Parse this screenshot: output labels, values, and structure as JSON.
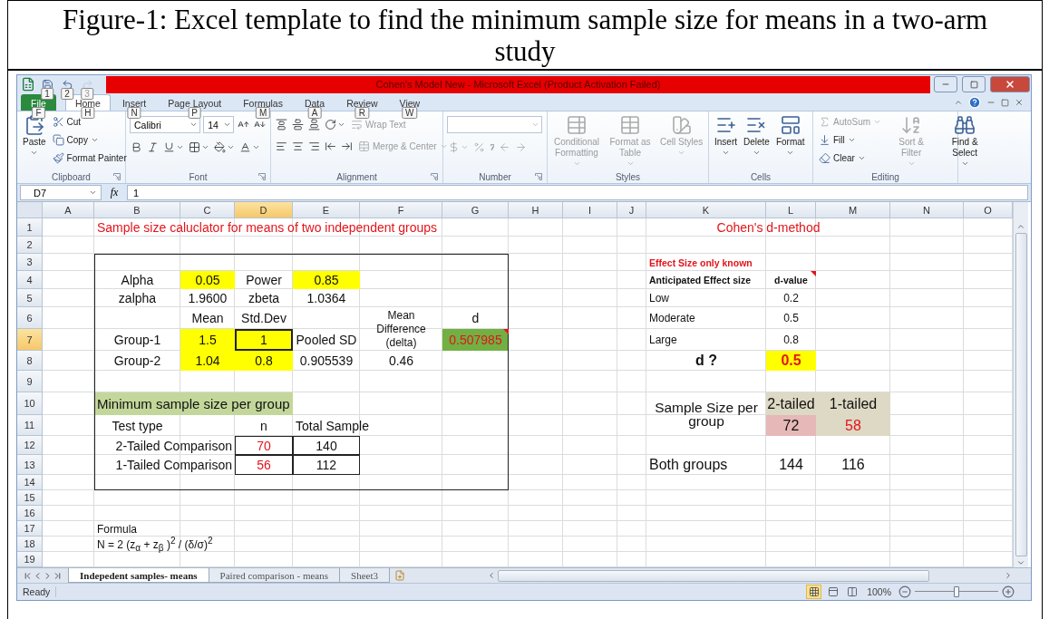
{
  "caption": "Figure-1: Excel template to find the minimum sample size for means in a two-arm study",
  "window": {
    "title": "Cohen's Model New - Microsoft Excel (Product Activation Failed)"
  },
  "quick_access": [
    {
      "keytip": "1",
      "disabled": false
    },
    {
      "keytip": "2",
      "disabled": false
    },
    {
      "keytip": "3",
      "disabled": true
    }
  ],
  "ribbon_tabs": [
    {
      "label": "File",
      "keytip": "F",
      "kind": "file",
      "selected": false
    },
    {
      "label": "Home",
      "keytip": "H",
      "kind": "tab",
      "selected": true
    },
    {
      "label": "Insert",
      "keytip": "N",
      "kind": "tab",
      "selected": false
    },
    {
      "label": "Page Layout",
      "keytip": "P",
      "kind": "tab",
      "selected": false
    },
    {
      "label": "Formulas",
      "keytip": "M",
      "kind": "tab",
      "selected": false
    },
    {
      "label": "Data",
      "keytip": "A",
      "kind": "tab",
      "selected": false
    },
    {
      "label": "Review",
      "keytip": "R",
      "kind": "tab",
      "selected": false
    },
    {
      "label": "View",
      "keytip": "W",
      "kind": "tab",
      "selected": false
    }
  ],
  "ribbon_groups": [
    {
      "label": "Clipboard",
      "kind": "stack",
      "launcher": true,
      "buttons": [
        {
          "label": "Paste",
          "kind": "large",
          "dropdown": true,
          "disabled": false
        },
        {
          "label": "Cut",
          "kind": "small",
          "dropdown": false,
          "disabled": false
        },
        {
          "label": "Copy",
          "kind": "small",
          "dropdown": true,
          "disabled": false
        },
        {
          "label": "Format Painter",
          "kind": "small",
          "dropdown": false,
          "disabled": false
        }
      ]
    },
    {
      "label": "Font",
      "kind": "rows",
      "launcher": true,
      "rows": [
        [
          {
            "kind": "field",
            "value": "Calibri"
          },
          {
            "kind": "field",
            "value": "14"
          },
          {
            "kind": "icon",
            "dropdown": false,
            "disabled": false
          },
          {
            "kind": "icon",
            "dropdown": false,
            "disabled": false
          }
        ],
        [
          {
            "kind": "icon",
            "dropdown": false,
            "disabled": false
          },
          {
            "kind": "icon",
            "dropdown": false,
            "disabled": false
          },
          {
            "kind": "icon",
            "dropdown": true,
            "disabled": false
          },
          {
            "kind": "icon",
            "dropdown": true,
            "disabled": false
          },
          {
            "kind": "icon",
            "dropdown": true,
            "disabled": false
          },
          {
            "kind": "icon",
            "dropdown": true,
            "disabled": false
          }
        ]
      ]
    },
    {
      "label": "Alignment",
      "kind": "rows",
      "launcher": true,
      "rows": [
        [
          {
            "kind": "icon",
            "dropdown": false,
            "disabled": false
          },
          {
            "kind": "icon",
            "dropdown": false,
            "disabled": false
          },
          {
            "kind": "icon",
            "dropdown": false,
            "disabled": false
          },
          {
            "kind": "icon",
            "dropdown": true,
            "disabled": false
          },
          {
            "kind": "small",
            "label": "Wrap Text",
            "dropdown": false,
            "disabled": true
          }
        ],
        [
          {
            "kind": "icon",
            "dropdown": false,
            "disabled": false
          },
          {
            "kind": "icon",
            "dropdown": false,
            "disabled": false
          },
          {
            "kind": "icon",
            "dropdown": false,
            "disabled": false
          },
          {
            "kind": "icon",
            "dropdown": false,
            "disabled": false
          },
          {
            "kind": "icon",
            "dropdown": false,
            "disabled": false
          },
          {
            "kind": "small",
            "label": "Merge & Center",
            "dropdown": true,
            "disabled": true
          }
        ]
      ]
    },
    {
      "label": "Number",
      "kind": "rows",
      "launcher": true,
      "rows": [
        [
          {
            "kind": "field"
          }
        ],
        [
          {
            "kind": "icon",
            "dropdown": true,
            "disabled": true
          },
          {
            "kind": "icon",
            "dropdown": false,
            "disabled": true
          },
          {
            "kind": "icon",
            "dropdown": false,
            "disabled": true
          },
          {
            "kind": "icon",
            "dropdown": false,
            "disabled": true
          },
          {
            "kind": "icon",
            "dropdown": false,
            "disabled": true
          }
        ]
      ]
    },
    {
      "label": "Styles",
      "kind": "stack",
      "launcher": false,
      "buttons": [
        {
          "label": "Conditional Formatting",
          "kind": "large",
          "dropdown": true,
          "disabled": true
        },
        {
          "label": "Format as Table",
          "kind": "large",
          "dropdown": true,
          "disabled": true
        },
        {
          "label": "Cell Styles",
          "kind": "large",
          "dropdown": true,
          "disabled": true
        }
      ]
    },
    {
      "label": "Cells",
      "kind": "stack",
      "launcher": false,
      "buttons": [
        {
          "label": "Insert",
          "kind": "large",
          "dropdown": true,
          "disabled": false
        },
        {
          "label": "Delete",
          "kind": "large",
          "dropdown": true,
          "disabled": false
        },
        {
          "label": "Format",
          "kind": "large",
          "dropdown": true,
          "disabled": false
        }
      ]
    },
    {
      "label": "Editing",
      "kind": "stack",
      "launcher": false,
      "buttons": [
        {
          "label": "AutoSum",
          "kind": "small",
          "dropdown": true,
          "disabled": true
        },
        {
          "label": "Fill",
          "kind": "small",
          "dropdown": true,
          "disabled": false
        },
        {
          "label": "Clear",
          "kind": "small",
          "dropdown": true,
          "disabled": false
        },
        {
          "label": "Sort & Filter",
          "kind": "large",
          "dropdown": true,
          "disabled": true
        },
        {
          "label": "Find & Select",
          "kind": "large",
          "dropdown": true,
          "disabled": false
        }
      ]
    }
  ],
  "formula_bar": {
    "name_box": "D7",
    "fx": "fx",
    "value": "1"
  },
  "sheet": {
    "columns": [
      {
        "label": "A",
        "selected": false
      },
      {
        "label": "B",
        "selected": false
      },
      {
        "label": "C",
        "selected": false
      },
      {
        "label": "D",
        "selected": true
      },
      {
        "label": "E",
        "selected": false
      },
      {
        "label": "F",
        "selected": false
      },
      {
        "label": "G",
        "selected": false
      },
      {
        "label": "H",
        "selected": false
      },
      {
        "label": "I",
        "selected": false
      },
      {
        "label": "J",
        "selected": false
      },
      {
        "label": "K",
        "selected": false
      },
      {
        "label": "L",
        "selected": false
      },
      {
        "label": "M",
        "selected": false
      },
      {
        "label": "N",
        "selected": false
      },
      {
        "label": "O",
        "selected": false
      }
    ],
    "rows": [
      {
        "number": "1",
        "selected": false,
        "cells": [
          "",
          {
            "text": "Sample size caluclator for means of two independent groups",
            "kind": "title",
            "alert": true
          },
          "",
          "",
          "",
          "",
          "",
          "",
          "",
          "",
          {
            "text": "Cohen's d-method",
            "kind": "heading",
            "alert": true
          }
        ]
      },
      {
        "number": "2",
        "selected": false,
        "cells": []
      },
      {
        "number": "3",
        "selected": false,
        "cells": [
          "",
          "",
          "",
          "",
          "",
          "",
          "",
          "",
          "",
          "",
          {
            "text": "Effect Size only known",
            "kind": "small-bold-left",
            "alert": true
          }
        ]
      },
      {
        "number": "4",
        "selected": false,
        "cells": [
          "",
          {
            "text": "Alpha",
            "kind": "label"
          },
          {
            "text": "0.05",
            "kind": "input"
          },
          {
            "text": "Power",
            "kind": "label"
          },
          {
            "text": "0.85",
            "kind": "input"
          },
          "",
          "",
          "",
          "",
          "",
          {
            "text": "Anticipated Effect size",
            "kind": "small-bold-left"
          },
          {
            "text": "d-value",
            "kind": "small-bold",
            "comment": true
          }
        ]
      },
      {
        "number": "5",
        "selected": false,
        "cells": [
          "",
          {
            "text": "zalpha",
            "kind": "label"
          },
          {
            "text": "1.9600",
            "kind": "label"
          },
          {
            "text": "zbeta",
            "kind": "label"
          },
          {
            "text": "1.0364",
            "kind": "label"
          },
          "",
          "",
          "",
          "",
          "",
          {
            "text": "Low",
            "kind": "small-left"
          },
          {
            "text": "0.2",
            "kind": "small"
          }
        ]
      },
      {
        "number": "6",
        "selected": false,
        "cells": [
          "",
          "",
          {
            "text": "Mean",
            "kind": "label"
          },
          {
            "text": "Std.Dev",
            "kind": "label"
          },
          "",
          "",
          {
            "text": "d",
            "kind": "label"
          },
          "",
          "",
          "",
          {
            "text": "Moderate",
            "kind": "small-left"
          },
          {
            "text": "0.5",
            "kind": "small"
          }
        ]
      },
      {
        "number": "7",
        "selected": true,
        "cells": [
          "",
          {
            "text": "Group-1",
            "kind": "label"
          },
          {
            "text": "1.5",
            "kind": "input"
          },
          {
            "text": "1",
            "kind": "input"
          },
          {
            "text": "Pooled SD",
            "kind": "label"
          },
          {
            "text": "Mean Difference (delta)",
            "kind": "wrap"
          },
          {
            "text": "0.507985",
            "kind": "result",
            "alert": true,
            "comment": true
          },
          "",
          "",
          "",
          {
            "text": "Large",
            "kind": "small-left"
          },
          {
            "text": "0.8",
            "kind": "small"
          }
        ]
      },
      {
        "number": "8",
        "selected": false,
        "cells": [
          "",
          {
            "text": "Group-2",
            "kind": "label"
          },
          {
            "text": "1.04",
            "kind": "input"
          },
          {
            "text": "0.8",
            "kind": "input"
          },
          {
            "text": "0.905539",
            "kind": "label"
          },
          {
            "text": "0.46",
            "kind": "label"
          },
          "",
          "",
          "",
          "",
          {
            "text": "d ?",
            "kind": "big-bold"
          },
          {
            "text": "0.5",
            "kind": "input-bold",
            "alert": true
          }
        ]
      },
      {
        "number": "9",
        "selected": false,
        "cells": []
      },
      {
        "number": "10",
        "selected": false,
        "cells": [
          "",
          {
            "text": "Minimum sample size per group",
            "kind": "banner"
          },
          "",
          "",
          "",
          "",
          "",
          "",
          "",
          "",
          {
            "text": "Sample Size per group",
            "kind": "big-wrap"
          },
          {
            "text": "2-tailed",
            "kind": "tan"
          },
          {
            "text": "1-tailed",
            "kind": "tan"
          }
        ]
      },
      {
        "number": "11",
        "selected": false,
        "cells": [
          "",
          {
            "text": "Test type",
            "kind": "label"
          },
          "",
          {
            "text": "n",
            "kind": "label"
          },
          {
            "text": "Total Sample",
            "kind": "label-left"
          },
          "",
          "",
          "",
          "",
          "",
          "",
          {
            "text": "72",
            "kind": "pink"
          },
          {
            "text": "58",
            "kind": "tan",
            "alert": true
          }
        ]
      },
      {
        "number": "12",
        "selected": false,
        "cells": [
          "",
          "",
          {
            "text": "2-Tailed Comparison",
            "kind": "label-right"
          },
          {
            "text": "70",
            "kind": "boxed",
            "alert": true
          },
          {
            "text": "140",
            "kind": "boxed"
          }
        ]
      },
      {
        "number": "13",
        "selected": false,
        "cells": [
          "",
          "",
          {
            "text": "1-Tailed Comparison",
            "kind": "label-right"
          },
          {
            "text": "56",
            "kind": "boxed",
            "alert": true
          },
          {
            "text": "112",
            "kind": "boxed"
          },
          "",
          "",
          "",
          "",
          "",
          {
            "text": "Both groups",
            "kind": "big-left"
          },
          {
            "text": "144",
            "kind": "big"
          },
          {
            "text": "116",
            "kind": "big"
          }
        ]
      },
      {
        "number": "14",
        "selected": false,
        "cells": []
      },
      {
        "number": "15",
        "selected": false,
        "cells": []
      },
      {
        "number": "16",
        "selected": false,
        "cells": []
      },
      {
        "number": "17",
        "selected": false,
        "cells": [
          "",
          {
            "text": "Formula",
            "kind": "formula"
          }
        ]
      },
      {
        "number": "18",
        "selected": false,
        "cells": [
          "",
          {
            "text": "N = 2 (z$_{α}$ + z$_{β}$ )$^{2}$ / (δ/σ)$^{2}$",
            "kind": "formula"
          }
        ]
      },
      {
        "number": "19",
        "selected": false,
        "cells": []
      }
    ]
  },
  "sheet_tabs": [
    {
      "label": "Indepedent samples- means",
      "selected": true
    },
    {
      "label": "Paired comparison - means",
      "selected": false
    },
    {
      "label": "Sheet3",
      "selected": false
    }
  ],
  "status_bar": {
    "text": "Ready",
    "zoom": "100%",
    "zoom_slider": {
      "level": 0.5
    },
    "views": [
      {
        "selected": true
      },
      {
        "selected": false
      },
      {
        "selected": false
      }
    ]
  }
}
